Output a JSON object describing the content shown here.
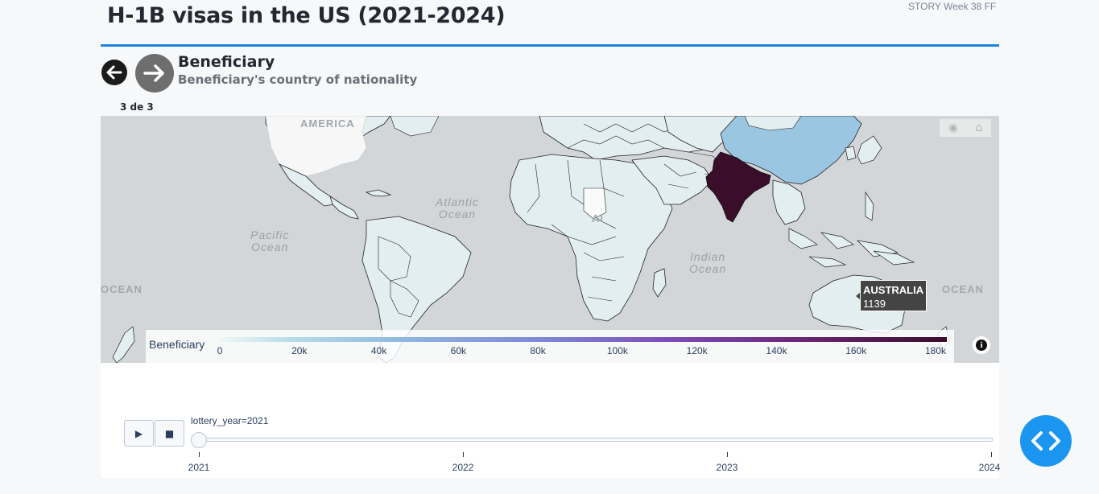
{
  "header": {
    "title": "H-1B visas in the US (2021-2024)",
    "story_tag": "STORY Week 38 FF"
  },
  "section": {
    "title": "Beneficiary",
    "subtitle": "Beneficiary's country of nationality",
    "pager": "3 de 3"
  },
  "nav": {
    "prev_icon": "arrow-left-icon",
    "next_icon": "arrow-right-icon"
  },
  "map": {
    "labels": {
      "america": "AMERICA",
      "atlantic_line1": "Atlantic",
      "atlantic_line2": "Ocean",
      "pacific_line1": "Pacific",
      "pacific_line2": "Ocean",
      "indian_line1": "Indian",
      "indian_line2": "Ocean",
      "ocean_left": "OCEAN",
      "ocean_right": "OCEAN",
      "africa_partial": "AI"
    },
    "modebar_icons": [
      "camera-icon",
      "home-icon"
    ],
    "highlighted": {
      "india": "#3a0d2b",
      "china": "#9ac6e2",
      "default": "#e3eef0",
      "usa": "#f7f7f7"
    },
    "tooltip": {
      "country": "AUSTRALIA",
      "value": "1139"
    }
  },
  "colorbar": {
    "title": "Beneficiary",
    "ticks": [
      "0",
      "20k",
      "40k",
      "60k",
      "80k",
      "100k",
      "120k",
      "140k",
      "160k",
      "180k"
    ],
    "min": 0,
    "max": 180000
  },
  "slider": {
    "current_label": "lottery_year=2021",
    "play_icon": "play-icon",
    "stop_icon": "stop-icon",
    "steps": [
      "2021",
      "2022",
      "2023",
      "2024"
    ],
    "current_index": 0
  },
  "fab": {
    "icon": "code-icon"
  }
}
